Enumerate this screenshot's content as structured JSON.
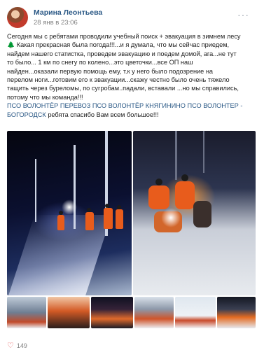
{
  "post": {
    "author": "Марина Леонтьева",
    "date": "28 янв в 23:06",
    "lines": [
      "Сегодня мы с ребятами проводили учебный поиск + эвакуация в зимнем лесу",
      "Какая прекрасная была погода!!!...и я думала, что мы сейчас приедем,",
      "найдем нашего статистка, проведем эвакуацию и поедем домой, ага...не тут",
      "то было... 1 км по снегу по колено...это цветочки...все ОП наш",
      "найден...оказали первую помощь ему, т.к у него было подозрение на",
      "перелом ноги...готовим его к эвакуации...скажу честно было очень тяжело",
      "тащить через буреломы, по сугробам..падали, вставали ...но мы справились,",
      "потому что мы команда!!!"
    ],
    "tags": {
      "line1": "ПСО ВОЛОНТЁР ПЕРЕВОЗ ПСО ВОЛОНТЁР КНЯГИНИНО ПСО ВОЛОНТЕР -",
      "line2_link": "БОГОРОДСК",
      "line2_rest": " ребята спасибо Вам всем большое!!!"
    },
    "tree_emoji": "🌲"
  },
  "likes": {
    "count": "149",
    "icon": "heart-icon"
  },
  "colors": {
    "link": "#2a5885",
    "secondary": "#828282",
    "like": "#e64646"
  }
}
